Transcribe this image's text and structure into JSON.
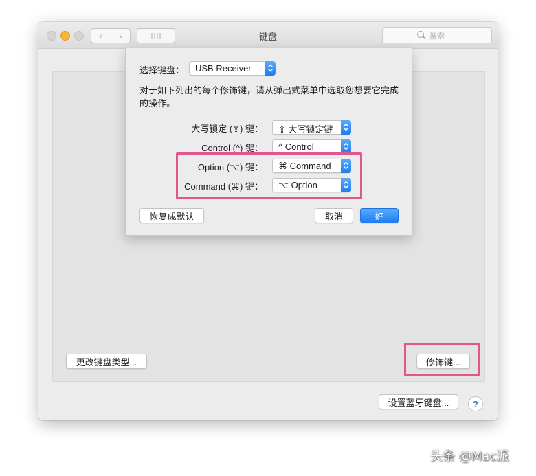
{
  "window": {
    "title": "键盘",
    "search_placeholder": "搜索"
  },
  "main": {
    "change_keyboard_type_label": "更改键盘类型...",
    "modifier_keys_label": "修饰键...",
    "setup_bluetooth_label": "设置蓝牙键盘...",
    "help_label": "?"
  },
  "sheet": {
    "select_keyboard_label": "选择键盘：",
    "selected_keyboard": "USB Receiver",
    "description": "对于如下列出的每个修饰键，请从弹出式菜单中选取您想要它完成的操作。",
    "rows": [
      {
        "label": "大写锁定 (⇪) 键：",
        "value": "⇪ 大写锁定键"
      },
      {
        "label": "Control (^) 键：",
        "value": "^ Control"
      },
      {
        "label": "Option (⌥) 键：",
        "value": "⌘ Command"
      },
      {
        "label": "Command (⌘) 键：",
        "value": "⌥ Option"
      }
    ],
    "restore_defaults_label": "恢复成默认",
    "cancel_label": "取消",
    "ok_label": "好"
  },
  "watermark": "头条 @Mac派",
  "colors": {
    "accent": "#1d7df3",
    "highlight": "#e2568f"
  }
}
